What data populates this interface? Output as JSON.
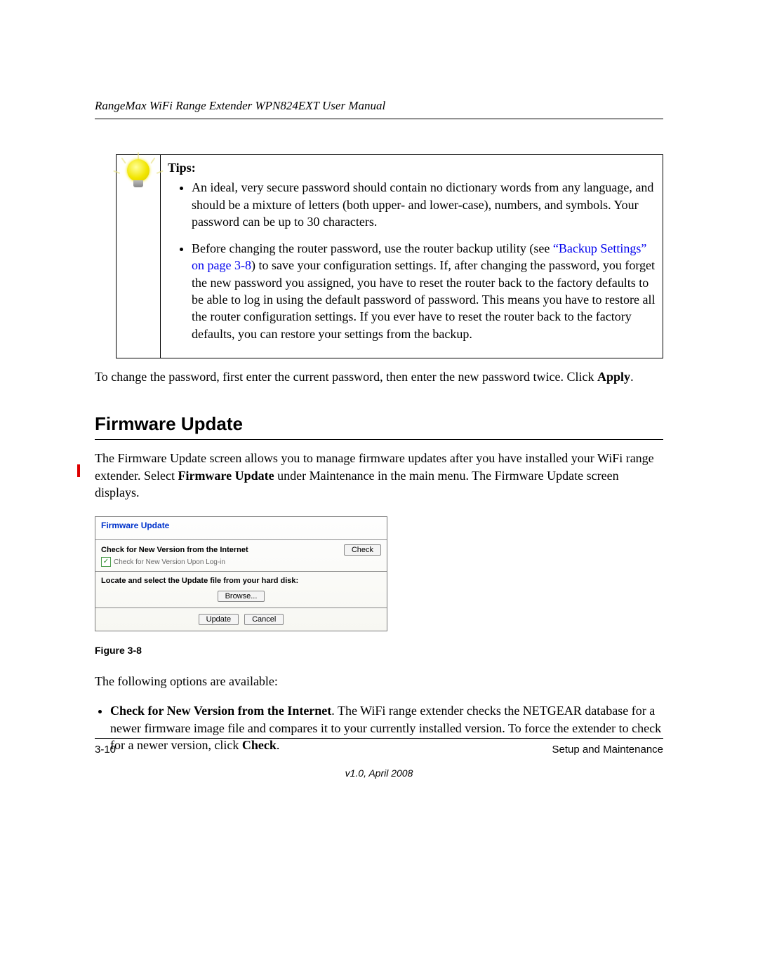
{
  "header": {
    "running": "RangeMax WiFi Range Extender WPN824EXT User Manual"
  },
  "tips": {
    "label": "Tips:",
    "items": [
      {
        "text_before": "An ideal, very secure password should contain no dictionary words from any language, and should be a mixture of letters (both upper- and lower-case), numbers, and symbols. Your password can be up to 30 characters.",
        "link": "",
        "text_after": ""
      },
      {
        "text_before": "Before changing the router password, use the router backup utility (see ",
        "link": "“Backup Settings” on page 3-8",
        "text_after": ") to save your configuration settings. If, after changing the password, you forget the new password you assigned, you have to reset the router back to the factory defaults to be able to log in using the default password of password. This means you have to restore all the router configuration settings. If you ever have to reset the router back to the factory defaults, you can restore your settings from the backup."
      }
    ]
  },
  "para_change": {
    "before": "To change the password, first enter the current password, then enter the new password twice. Click ",
    "bold": "Apply",
    "after": "."
  },
  "h2": "Firmware Update",
  "para_fw": {
    "p1a": "The Firmware Update screen allows you to manage firmware updates after you have installed your WiFi range extender. Select ",
    "p1b_bold": "Firmware Update",
    "p1c": " under Maintenance in the main menu. The Firmware Update screen displays."
  },
  "panel": {
    "title": "Firmware Update",
    "row_label": "Check for New Version from the Internet",
    "check_btn": "Check",
    "sub_label": "Check for New Version Upon Log-in",
    "locate_label": "Locate and select the Update file from your hard disk:",
    "browse_btn": "Browse...",
    "update_btn": "Update",
    "cancel_btn": "Cancel"
  },
  "figure_caption": "Figure 3-8",
  "para_options": "The following options are available:",
  "bullet1": {
    "b1_bold": "Check for New Version from the Internet",
    "b1_rest": ". The WiFi range extender checks the NETGEAR database for a newer firmware image file and compares it to your currently installed version. To force the extender to check for a newer version, click ",
    "b1_bold2": "Check",
    "b1_end": "."
  },
  "footer": {
    "left": "3-10",
    "right": "Setup and Maintenance",
    "version": "v1.0, April 2008"
  }
}
